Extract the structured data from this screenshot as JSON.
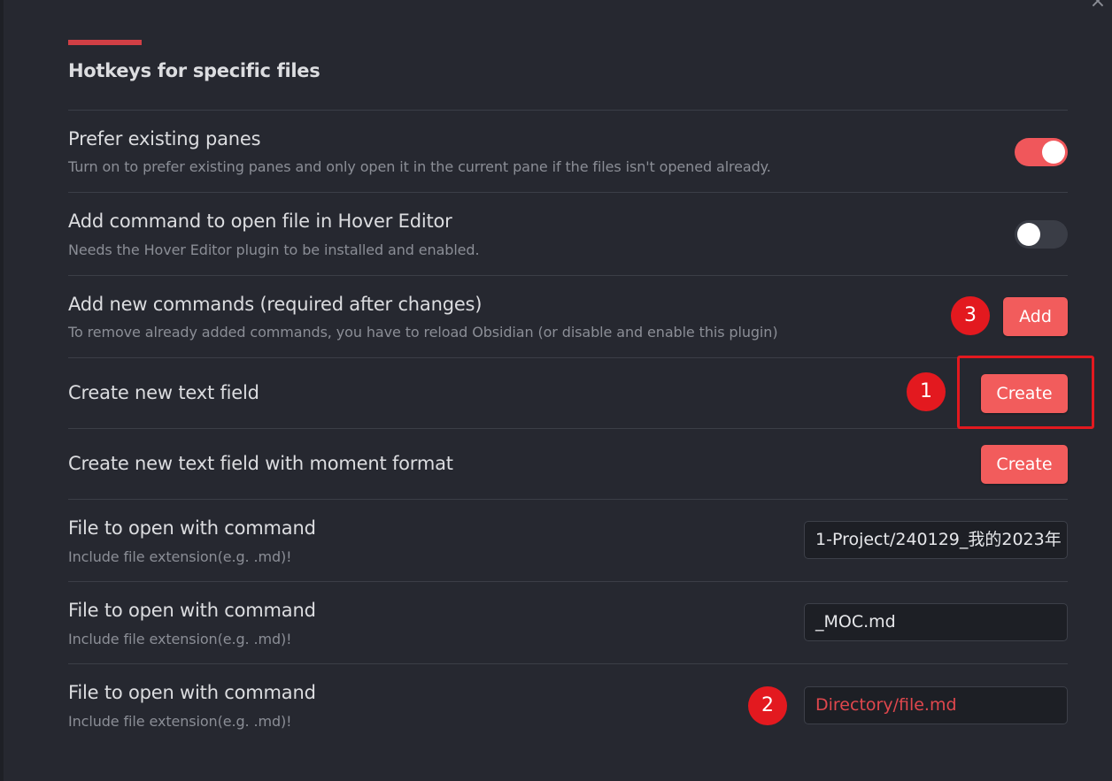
{
  "window": {
    "close_symbol": "×"
  },
  "section": {
    "title": "Hotkeys for specific files"
  },
  "settings": {
    "prefer_panes": {
      "name": "Prefer existing panes",
      "desc": "Turn on to prefer existing panes and only open it in the current pane if the files isn't opened already.",
      "toggle_on": true
    },
    "hover_editor": {
      "name": "Add command to open file in Hover Editor",
      "desc": "Needs the Hover Editor plugin to be installed and enabled.",
      "toggle_on": false
    },
    "add_commands": {
      "name": "Add new commands (required after changes)",
      "desc": "To remove already added commands, you have to reload Obsidian (or disable and enable this plugin)",
      "button": "Add"
    },
    "new_text_field": {
      "name": "Create new text field",
      "button": "Create"
    },
    "new_moment_field": {
      "name": "Create new text field with moment format",
      "button": "Create"
    },
    "files": [
      {
        "name": "File to open with command",
        "desc": "Include file extension(e.g. .md)!",
        "value": "1-Project/240129_我的2023年",
        "placeholder": ""
      },
      {
        "name": "File to open with command",
        "desc": "Include file extension(e.g. .md)!",
        "value": "_MOC.md",
        "placeholder": ""
      },
      {
        "name": "File to open with command",
        "desc": "Include file extension(e.g. .md)!",
        "value": "",
        "placeholder": "Directory/file.md"
      }
    ]
  },
  "annotations": {
    "badge_1": "1",
    "badge_2": "2",
    "badge_3": "3",
    "badge_color": "#e3191f"
  },
  "colors": {
    "background": "#262830",
    "accent": "#f25c5c",
    "accent_bar": "#d13f45",
    "toggle_on": "#f0575b"
  }
}
